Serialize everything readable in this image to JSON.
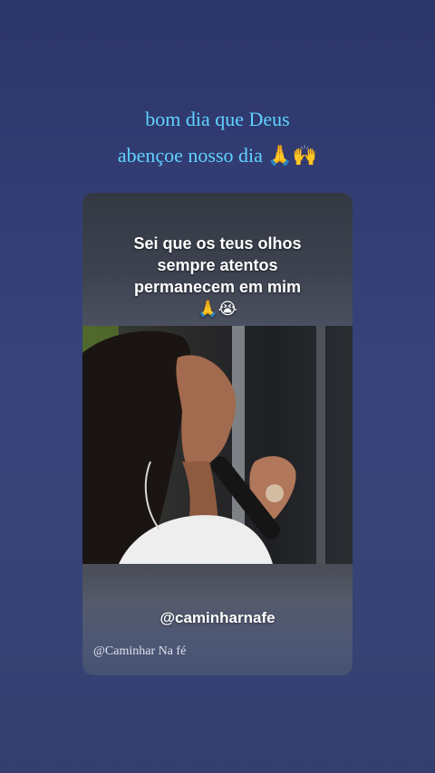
{
  "caption": {
    "line1": "bom dia que Deus",
    "line2": "abençoe nosso dia 🙏🙌"
  },
  "video_card": {
    "overlay_lines": [
      "Sei que os teus olhos",
      "sempre atentos",
      "permanecem em mim",
      "🙏😭"
    ],
    "handle": "@caminharnafe",
    "watermark": "@Caminhar Na fé"
  },
  "colors": {
    "background": "#354078",
    "caption_text": "#5fd3ff"
  },
  "image": {
    "subject": "woman singing into a microphone"
  }
}
